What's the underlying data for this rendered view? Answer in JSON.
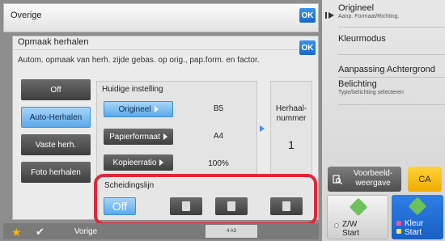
{
  "header": {
    "title": "Overige",
    "ok": "OK"
  },
  "dialog": {
    "title": "Opmaak herhalen",
    "ok": "OK",
    "description": "Autom. opmaak van herh. zijde gebas. op orig., pap.form. en factor.",
    "options": [
      "Off",
      "Auto-Herhalen",
      "Vaste herh.",
      "Foto herhalen"
    ],
    "selected_option": "Auto-Herhalen",
    "current": {
      "heading": "Huidige instelling",
      "rows": [
        {
          "label": "Origineel",
          "value": "B5"
        },
        {
          "label": "Papierformaat",
          "value": "A4"
        },
        {
          "label": "Kopieerratio",
          "value": "100%"
        }
      ]
    },
    "repeat": {
      "label_line1": "Herhaal-",
      "label_line2": "nummer",
      "value": "1"
    },
    "separator": {
      "heading": "Scheidingslijn",
      "off": "Off"
    }
  },
  "sidebar": {
    "items": [
      {
        "title": "Origineel",
        "sub": "Aanp. Formaat/Richting."
      },
      {
        "title": "Kleurmodus",
        "sub": ""
      },
      {
        "title": "Aanpassing Achtergrond",
        "sub": ""
      },
      {
        "title": "Belichting",
        "sub": "Type/belichting selecteren"
      }
    ],
    "preview_line1": "Voorbeeld-",
    "preview_line2": "weergave",
    "ca": "CA",
    "start_bw_1": "Z/W",
    "start_bw_2": "Start",
    "start_color_1": "Kleur",
    "start_color_2": "Start"
  },
  "bottom": {
    "back": "Vorige",
    "pages": "4      A3"
  },
  "colors": {
    "accent_blue": "#3a93f0",
    "highlight_red": "#e0263a",
    "ca_yellow": "#f0ac00"
  }
}
